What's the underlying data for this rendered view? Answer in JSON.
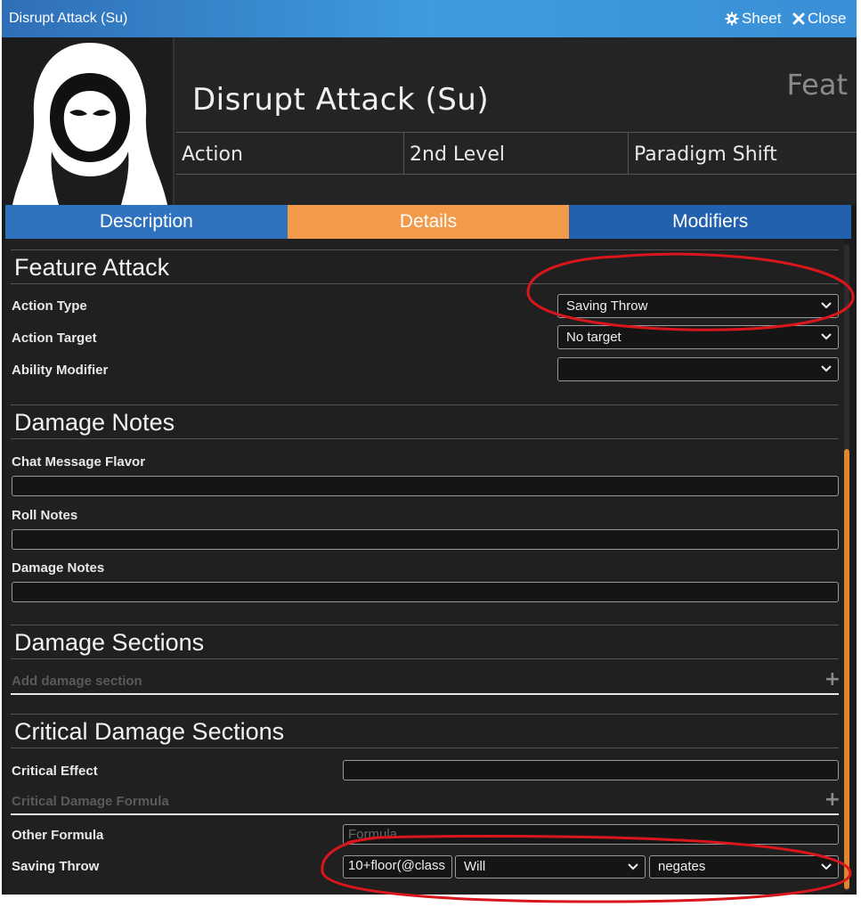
{
  "window": {
    "title": "Disrupt Attack (Su)",
    "sheet_label": "Sheet",
    "close_label": "Close"
  },
  "header": {
    "name": "Disrupt Attack (Su)",
    "type": "Feat",
    "summary": [
      "Action",
      "2nd Level",
      "Paradigm Shift"
    ]
  },
  "tabs": [
    {
      "label": "Description",
      "active": false
    },
    {
      "label": "Details",
      "active": true
    },
    {
      "label": "Modifiers",
      "active": false
    }
  ],
  "feature_attack": {
    "heading": "Feature Attack",
    "action_type_label": "Action Type",
    "action_type_value": "Saving Throw",
    "action_target_label": "Action Target",
    "action_target_value": "No target",
    "ability_modifier_label": "Ability Modifier",
    "ability_modifier_value": ""
  },
  "damage_notes": {
    "heading": "Damage Notes",
    "chat_flavor_label": "Chat Message Flavor",
    "roll_notes_label": "Roll Notes",
    "damage_notes_label": "Damage Notes"
  },
  "damage_sections": {
    "heading": "Damage Sections",
    "add_label": "Add damage section"
  },
  "critical": {
    "heading": "Critical Damage Sections",
    "effect_label": "Critical Effect",
    "formula_label": "Critical Damage Formula",
    "other_formula_label": "Other Formula",
    "other_formula_placeholder": "Formula",
    "saving_throw_label": "Saving Throw",
    "saving_throw_dc": "10+floor(@class",
    "saving_throw_type": "Will",
    "saving_throw_effect": "negates"
  },
  "colors": {
    "tab_active": "#f39a4a",
    "tab_inactive": "#2f72bd",
    "annotation": "#d8161b"
  }
}
